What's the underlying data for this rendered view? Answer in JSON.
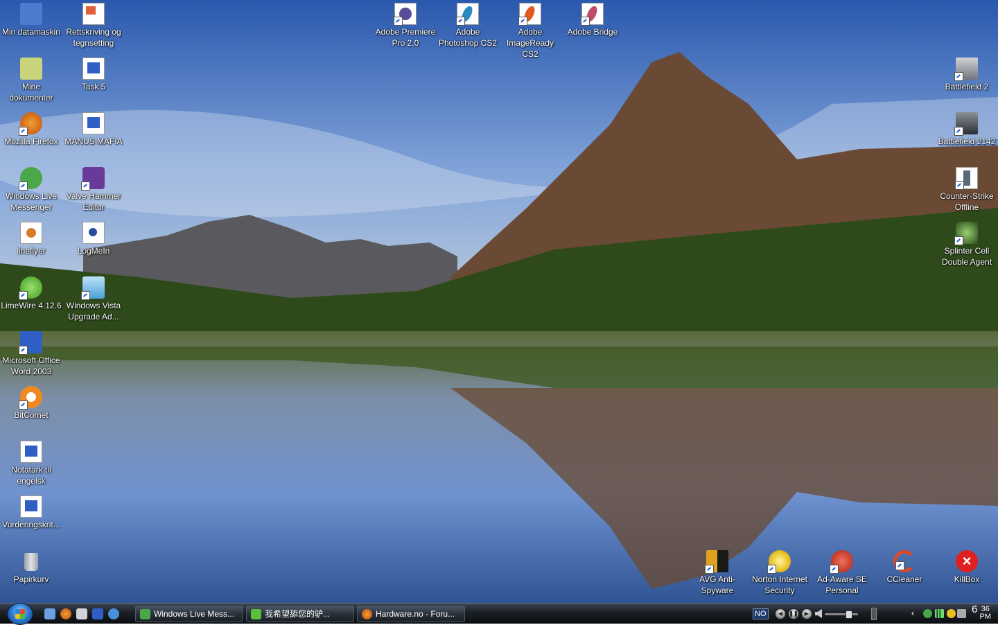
{
  "desktop": {
    "icons": [
      {
        "label": "Min datamaskin",
        "color": "#4c7ccf"
      },
      {
        "label": "Rettskriving og tegnsetting",
        "color": "#e0a070"
      },
      {
        "label": "Mine dokumenter",
        "color": "#c9d47a"
      },
      {
        "label": "Task 5",
        "color": "#2f5fc4"
      },
      {
        "label": "Mozilla Firefox",
        "color": "#e07a20"
      },
      {
        "label": "MANUS MAFIA",
        "color": "#2f5fc4"
      },
      {
        "label": "Windows Live Messenger",
        "color": "#4aa84a"
      },
      {
        "label": "Valve Hammer Editor",
        "color": "#6a3a9a"
      },
      {
        "label": "lineflyer",
        "color": "#d87a2a"
      },
      {
        "label": "LogMeIn",
        "color": "#2a4aa0"
      },
      {
        "label": "LimeWire 4.12.6",
        "color": "#5cbf3a"
      },
      {
        "label": "Windows Vista Upgrade Ad...",
        "color": "#4aa0d8"
      },
      {
        "label": "Microsoft Office Word 2003",
        "color": "#2f5fc4"
      },
      {
        "label": "BitComet",
        "color": "#f08a20"
      },
      {
        "label": "Notatark til engelsk",
        "color": "#2f5fc4"
      },
      {
        "label": "Vurderingskrit...",
        "color": "#2f5fc4"
      },
      {
        "label": "Papirkurv",
        "color": "#b8bcc4"
      },
      {
        "label": "Adobe Premiere Pro 2.0",
        "color": "#5a4a9a"
      },
      {
        "label": "Adobe Photoshop CS2",
        "color": "#2a8ac0"
      },
      {
        "label": "Adobe ImageReady CS2",
        "color": "#e05a20"
      },
      {
        "label": "Adobe Bridge",
        "color": "#c04a6a"
      },
      {
        "label": "Battlefield 2",
        "color": "#8a9098"
      },
      {
        "label": "Battlefield 2142",
        "color": "#4a5058"
      },
      {
        "label": "Counter-Strike Offline",
        "color": "#5a6a7a"
      },
      {
        "label": "Splinter Cell Double Agent",
        "color": "#4a7a3a"
      },
      {
        "label": "AVG Anti-Spyware",
        "color": "#e0a020"
      },
      {
        "label": "Norton Internet Security",
        "color": "#e8c020"
      },
      {
        "label": "Ad-Aware SE Personal",
        "color": "#d83a2a"
      },
      {
        "label": "CCleaner",
        "color": "#d84a2a"
      },
      {
        "label": "KillBox",
        "color": "#e02020"
      }
    ]
  },
  "taskbar": {
    "tasks": [
      {
        "label": "Windows Live Mess...",
        "color": "#4aa84a"
      },
      {
        "label": "我希望舔您的驴...",
        "color": "#5cbf3a"
      },
      {
        "label": "Hardware.no - Foru...",
        "color": "#e07a20"
      }
    ],
    "language": "NO",
    "clock_hour": "6",
    "clock_minute": "36",
    "clock_ampm": "PM",
    "volume_level": 0.7
  }
}
